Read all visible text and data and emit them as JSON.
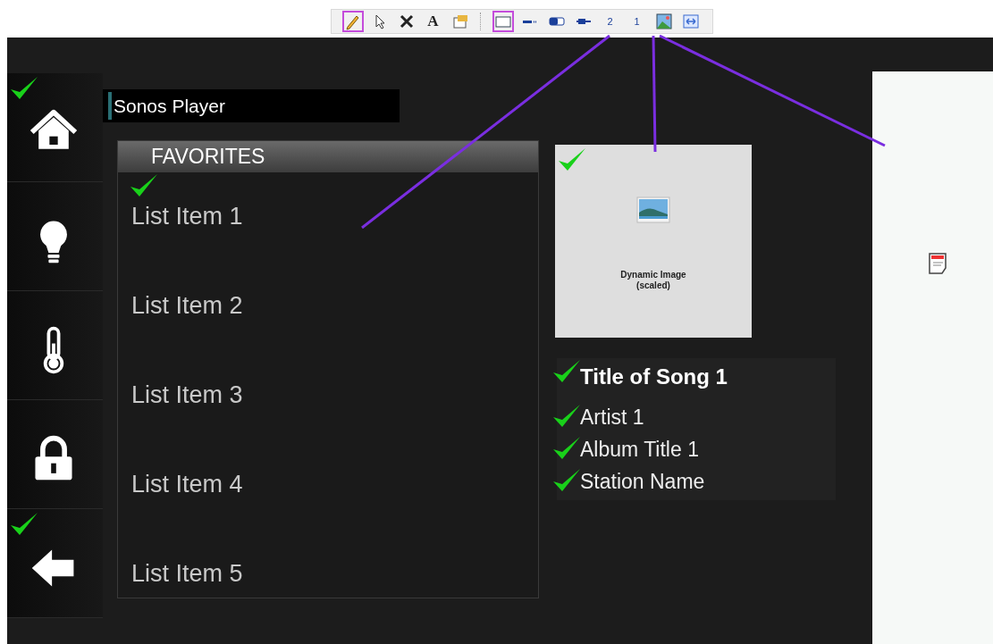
{
  "toolbar": [
    {
      "kind": "pencil",
      "selected": true
    },
    {
      "kind": "pointer",
      "selected": false
    },
    {
      "kind": "delete",
      "selected": false
    },
    {
      "kind": "text",
      "label": "A",
      "selected": false
    },
    {
      "kind": "properties",
      "selected": false
    },
    {
      "kind": "separator"
    },
    {
      "kind": "rectangle",
      "selected": true
    },
    {
      "kind": "arrow",
      "selected": false
    },
    {
      "kind": "toggle",
      "selected": false
    },
    {
      "kind": "slider",
      "selected": false
    },
    {
      "kind": "number",
      "label": "2",
      "selected": false
    },
    {
      "kind": "number",
      "label": "1",
      "selected": false
    },
    {
      "kind": "image",
      "selected": false
    },
    {
      "kind": "resize",
      "selected": false
    }
  ],
  "sidebar": {
    "items": [
      {
        "kind": "home",
        "checked": true
      },
      {
        "kind": "bulb",
        "checked": false
      },
      {
        "kind": "thermometer",
        "checked": false
      },
      {
        "kind": "lock",
        "checked": false
      },
      {
        "kind": "back",
        "checked": true
      }
    ]
  },
  "title_bar": {
    "title": "Sonos Player"
  },
  "favorites": {
    "header": "FAVORITES",
    "items": [
      {
        "label": "List Item 1",
        "checked": true
      },
      {
        "label": "List Item 2",
        "checked": false
      },
      {
        "label": "List Item 3",
        "checked": false
      },
      {
        "label": "List Item 4",
        "checked": false
      },
      {
        "label": "List Item 5",
        "checked": false
      }
    ]
  },
  "image_box": {
    "caption": "Dynamic Image",
    "subcaption": "(scaled)",
    "checked": true
  },
  "now_playing": [
    {
      "kind": "title",
      "text": "Title of Song 1",
      "checked": true
    },
    {
      "kind": "line",
      "text": "Artist 1",
      "checked": true
    },
    {
      "kind": "line",
      "text": "Album Title 1",
      "checked": true
    },
    {
      "kind": "line",
      "text": "Station Name",
      "checked": true
    }
  ]
}
